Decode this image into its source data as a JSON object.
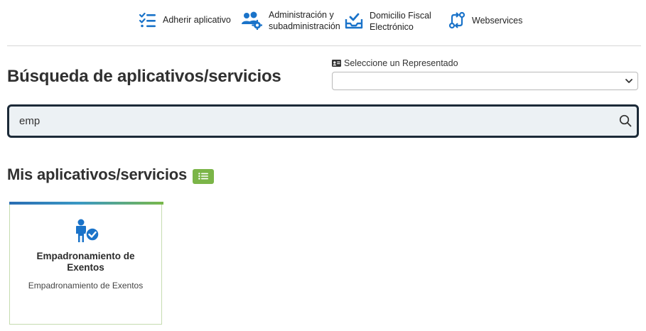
{
  "topnav": {
    "items": [
      {
        "icon": "checklist-icon",
        "lines": [
          "Adherir aplicativo"
        ]
      },
      {
        "icon": "users-gear-icon",
        "lines": [
          "Administración y",
          "subadministración"
        ]
      },
      {
        "icon": "inbox-check-icon",
        "lines": [
          "Domicilio Fiscal",
          "Electrónico"
        ]
      },
      {
        "icon": "webservices-icon",
        "lines": [
          "Webservices"
        ]
      }
    ]
  },
  "page": {
    "title": "Búsqueda de aplicativos/servicios"
  },
  "representado": {
    "label": "Seleccione un Representado",
    "selected": ""
  },
  "search": {
    "value": "emp"
  },
  "section": {
    "title": "Mis aplicativos/servicios"
  },
  "cards": [
    {
      "title_lines": [
        "Empadronamiento de",
        "Exentos"
      ],
      "subtitle": "Empadronamiento de Exentos",
      "icon": "person-check-icon"
    }
  ],
  "colors": {
    "accent_blue": "#1a73c9",
    "accent_green": "#7bb548",
    "search_border": "#1c2a38"
  }
}
